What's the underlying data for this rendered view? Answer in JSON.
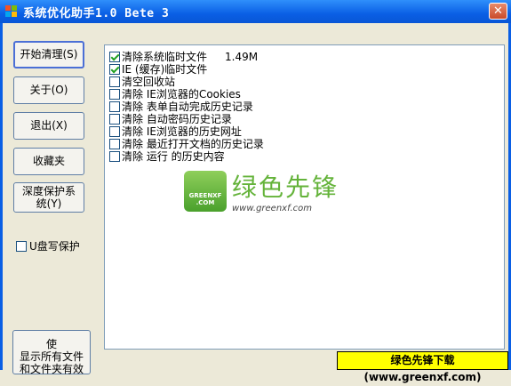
{
  "window": {
    "title": "系统优化助手1.0 Bete 3",
    "close_label": "✕"
  },
  "buttons": {
    "start_clean": "开始清理(S)",
    "about": "关于(O)",
    "exit": "退出(X)",
    "favorites": "收藏夹",
    "deep_protect_line1": "深度保护系",
    "deep_protect_line2": "统(Y)"
  },
  "usb_protect": {
    "label": "U盘写保护",
    "checked": false
  },
  "show_files_button": {
    "line1": "使",
    "line2": "显示所有文件",
    "line3": "和文件夹有效"
  },
  "clean_items": [
    {
      "label": "清除系统临时文件",
      "size": "1.49M",
      "checked": true
    },
    {
      "label": "IE (缓存)临时文件",
      "checked": true
    },
    {
      "label": "清空回收站",
      "checked": false
    },
    {
      "label": "清除 IE浏览器的Cookies",
      "checked": false
    },
    {
      "label": "清除 表单自动完成历史记录",
      "checked": false
    },
    {
      "label": "清除 自动密码历史记录",
      "checked": false
    },
    {
      "label": "清除 IE浏览器的历史网址",
      "checked": false
    },
    {
      "label": "清除 最近打开文档的历史记录",
      "checked": false
    },
    {
      "label": "清除 运行 的历史内容",
      "checked": false
    }
  ],
  "watermark": {
    "logo_text": "GREENXF\n.COM",
    "cn": "绿色先锋",
    "url": "www.greenxf.com"
  },
  "banner": {
    "text": "绿色先锋下载(www.greenxf.com)"
  }
}
